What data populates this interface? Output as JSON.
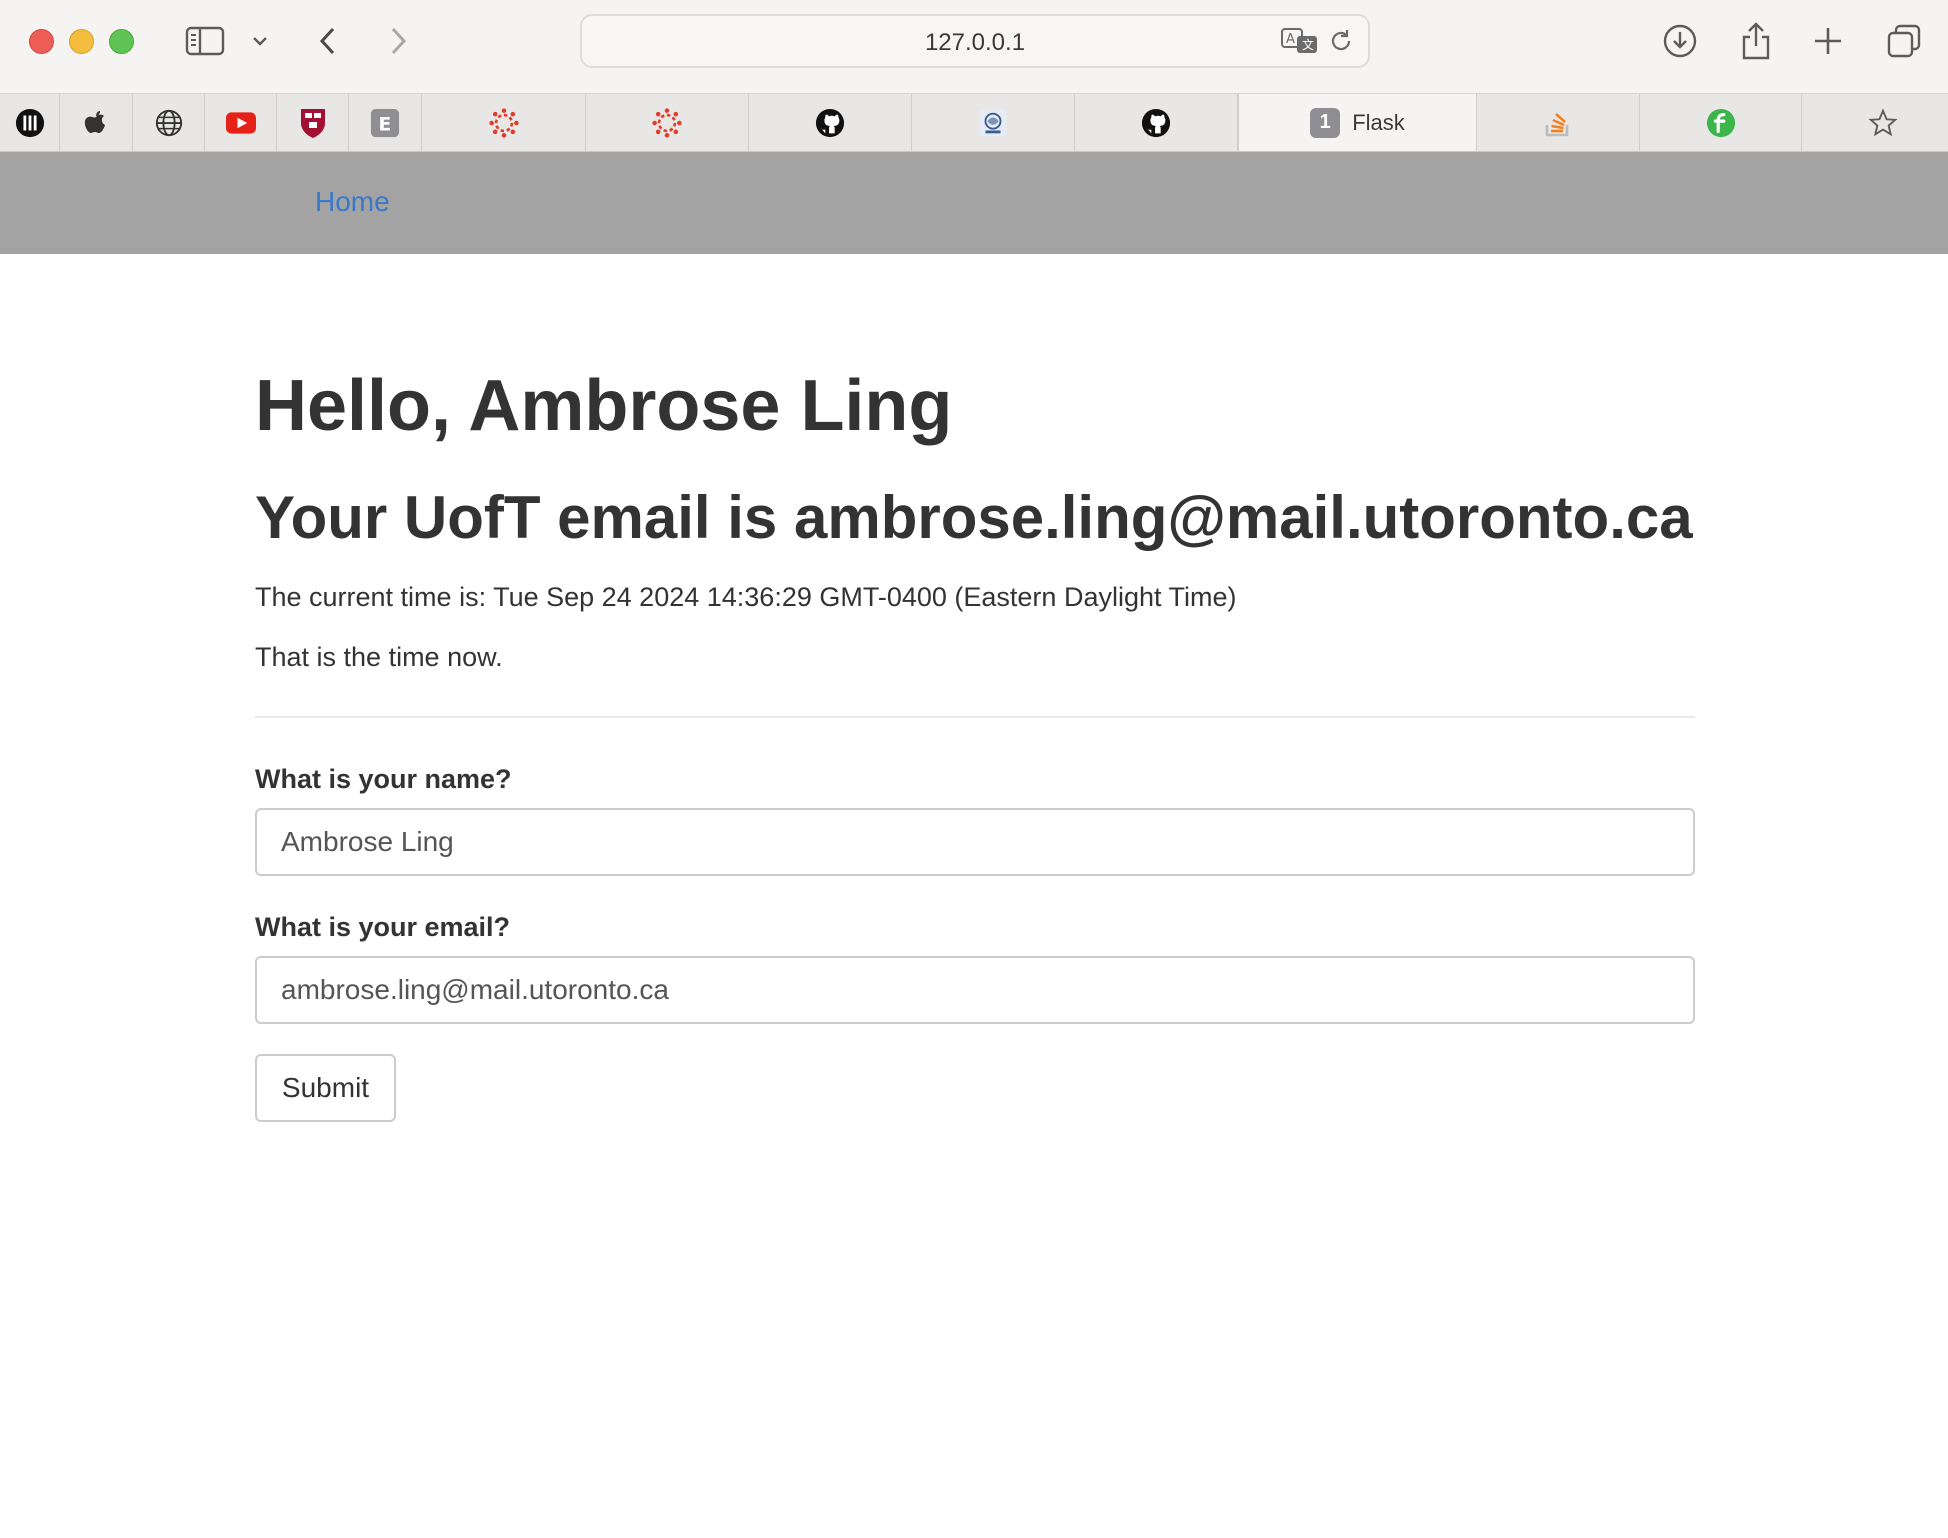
{
  "browser": {
    "url": "127.0.0.1",
    "tabs": [
      {
        "icon": "music-app-icon",
        "label": ""
      },
      {
        "icon": "apple-icon",
        "label": ""
      },
      {
        "icon": "globe-icon",
        "label": ""
      },
      {
        "icon": "youtube-icon",
        "label": ""
      },
      {
        "icon": "harvard-shield-icon",
        "label": ""
      },
      {
        "icon": "e-letter-icon",
        "label": "",
        "glyph": "E"
      },
      {
        "icon": "canvas-icon",
        "label": ""
      },
      {
        "icon": "canvas-icon",
        "label": ""
      },
      {
        "icon": "github-icon",
        "label": ""
      },
      {
        "icon": "university-seal-icon",
        "label": ""
      },
      {
        "icon": "github-icon",
        "label": ""
      },
      {
        "icon": "tab-number-badge",
        "label": "Flask",
        "badge": "1",
        "active": true
      },
      {
        "icon": "stackoverflow-icon",
        "label": ""
      },
      {
        "icon": "green-f-icon",
        "label": ""
      },
      {
        "icon": "star-icon",
        "label": ""
      }
    ]
  },
  "nav": {
    "home_label": "Home"
  },
  "page": {
    "greeting": "Hello, Ambrose Ling",
    "email_heading": "Your UofT email is ambrose.ling@mail.utoronto.ca",
    "time_line": "The current time is: Tue Sep 24 2024 14:36:29 GMT-0400 (Eastern Daylight Time)",
    "now_line": "That is the time now."
  },
  "form": {
    "name_label": "What is your name?",
    "name_value": "Ambrose Ling",
    "email_label": "What is your email?",
    "email_value": "ambrose.ling@mail.utoronto.ca",
    "submit_label": "Submit"
  },
  "colors": {
    "navbar": "#a3a3a3",
    "link": "#3a78c9",
    "text": "#333333"
  }
}
